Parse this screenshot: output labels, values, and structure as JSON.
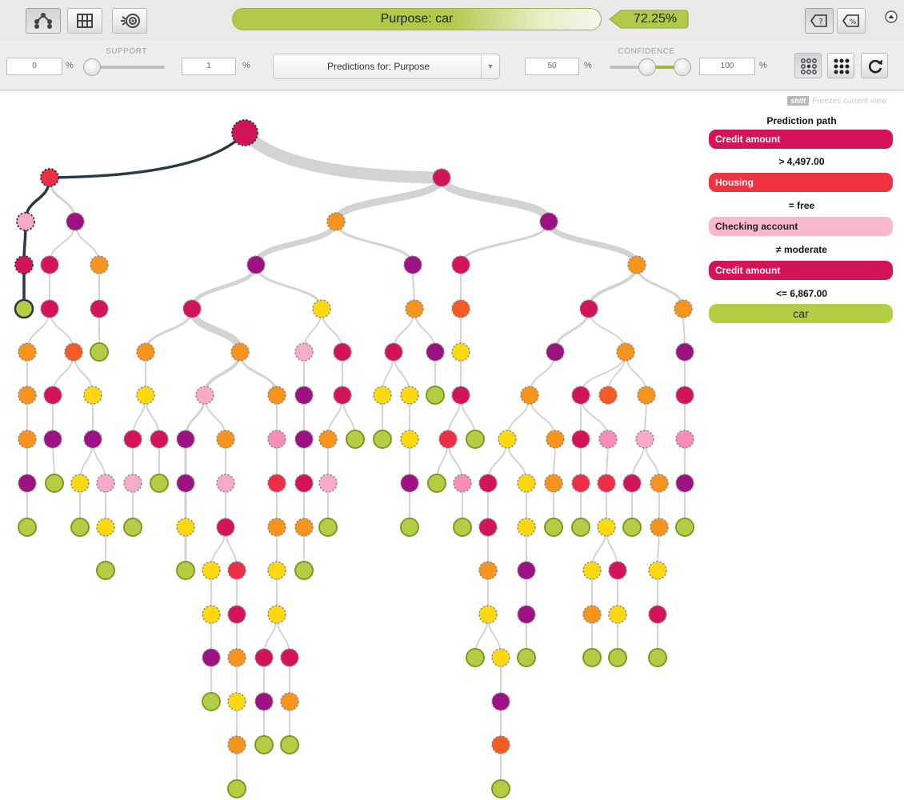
{
  "header": {
    "target_label": "Purpose: car",
    "confidence_tag": "72.25%",
    "colors": {
      "target_bar": "#afc94a",
      "tag": "#afc94a"
    }
  },
  "view_modes": {
    "tree_icon": "tree-view-icon",
    "sunburst_icon": "sunburst-view-icon",
    "grid_icon": "grid-view-icon"
  },
  "toolbar": {
    "support": {
      "label": "SUPPORT",
      "min_value": "0",
      "max_value": "1",
      "unit": "%"
    },
    "prediction_select": {
      "value": "Predictions for: Purpose"
    },
    "confidence": {
      "label": "CONFIDENCE",
      "min_value": "50",
      "max_value": "100",
      "unit": "%"
    }
  },
  "side_panel": {
    "shift_key": "shift",
    "shift_text": "Freezes current view",
    "title": "Prediction path",
    "path": [
      {
        "field": "Credit amount",
        "condition": "> 4,497.00",
        "color": "#d4145a"
      },
      {
        "field": "Housing",
        "condition": "= free",
        "color": "#ef3340"
      },
      {
        "field": "Checking account",
        "condition": "≠ moderate",
        "color": "#f8b9cf"
      },
      {
        "field": "Credit amount",
        "condition": "<= 6,867.00",
        "color": "#d4145a"
      }
    ],
    "prediction": "car"
  },
  "tree": {
    "node_colors": {
      "C": "#d4145a",
      "R": "#ee2d46",
      "P": "#f7aac9",
      "M": "#9c1282",
      "O": "#f7941d",
      "Y": "#fbd80f",
      "G": "#b3cd44",
      "F": "#f45b25",
      "K": "#f58fba"
    }
  }
}
